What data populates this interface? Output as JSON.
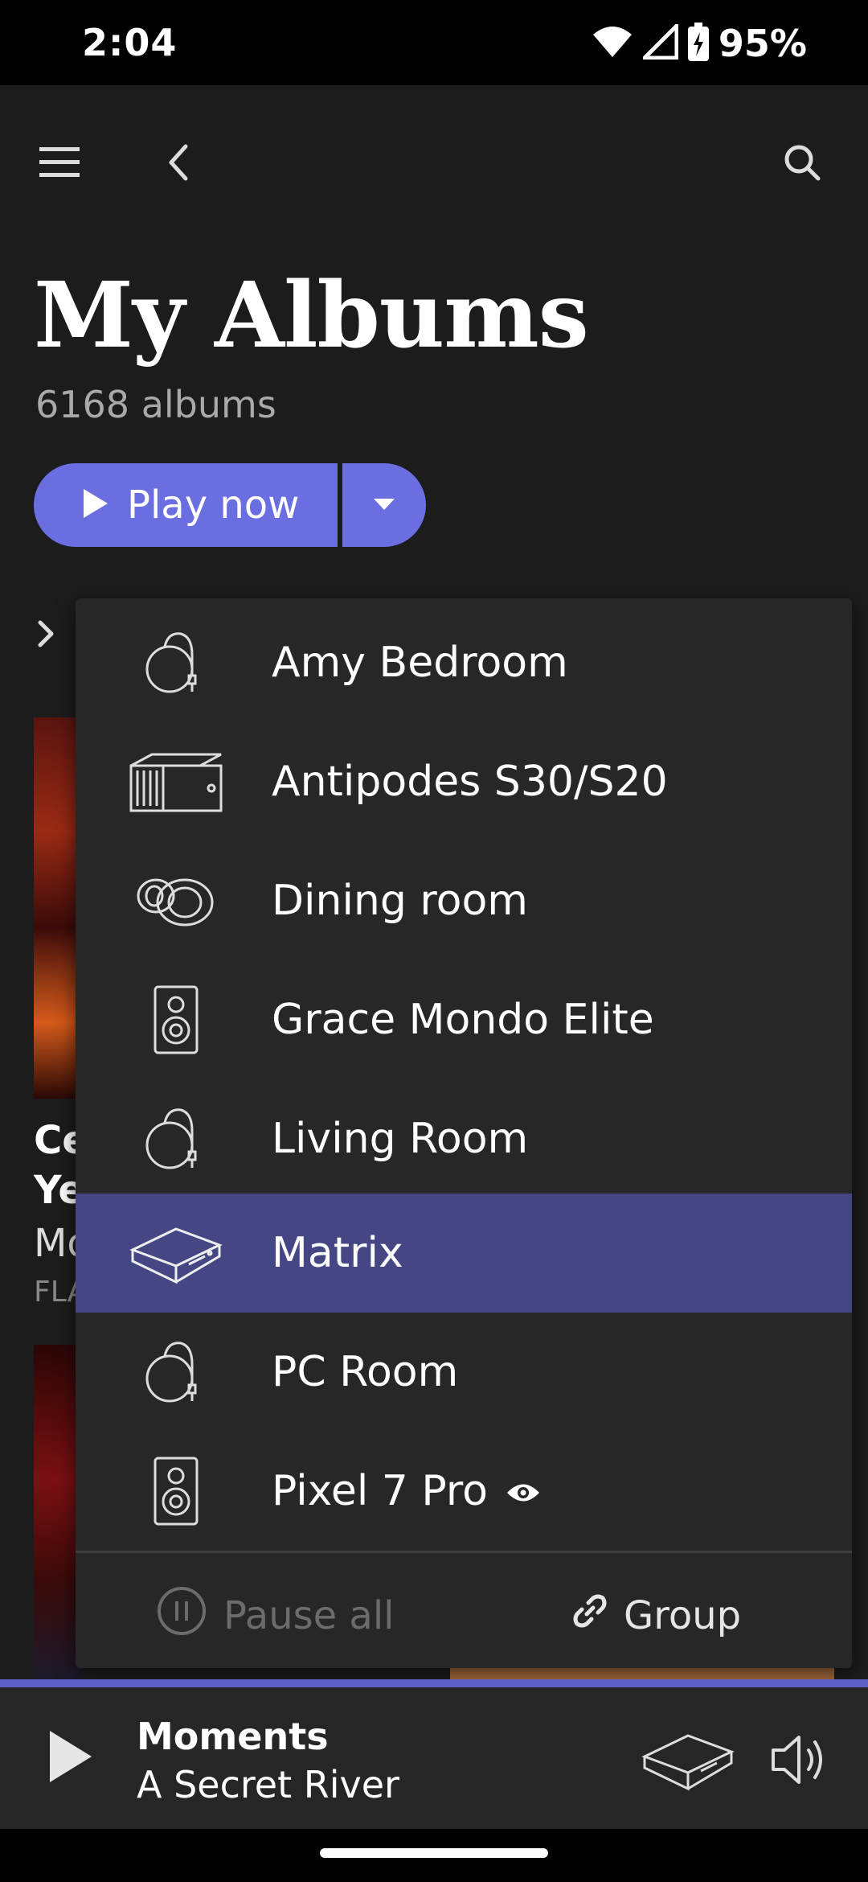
{
  "status_bar": {
    "time": "2:04",
    "battery": "95%",
    "icons": [
      "wifi-icon",
      "signal-icon",
      "battery-charging-icon"
    ]
  },
  "toolbar": {
    "icons": [
      "hamburger-menu-icon",
      "back-arrow-icon",
      "search-icon"
    ]
  },
  "page": {
    "title": "My Albums",
    "subtitle": "6168 albums"
  },
  "actions": {
    "play_now_label": "Play now",
    "dropdown_icon": "caret-down-icon"
  },
  "background_album": {
    "line1": "Ce",
    "line2": "Ye",
    "line3": "Mo",
    "line4": "FLA"
  },
  "zone_menu": {
    "items": [
      {
        "label": "Amy Bedroom",
        "icon": "round-speaker-icon",
        "selected": false
      },
      {
        "label": "Antipodes S30/S20",
        "icon": "server-box-icon",
        "selected": false
      },
      {
        "label": "Dining room",
        "icon": "oval-speaker-icon",
        "selected": false
      },
      {
        "label": "Grace Mondo Elite",
        "icon": "bookshelf-speaker-icon",
        "selected": false
      },
      {
        "label": "Living Room",
        "icon": "round-speaker-icon",
        "selected": false
      },
      {
        "label": "Matrix",
        "icon": "streamer-device-icon",
        "selected": true
      },
      {
        "label": "PC Room",
        "icon": "round-speaker-icon",
        "selected": false
      },
      {
        "label": "Pixel 7 Pro",
        "icon": "bookshelf-speaker-icon",
        "selected": false,
        "badge_icon": "eye-icon"
      }
    ],
    "pause_all_label": "Pause all",
    "group_label": "Group"
  },
  "now_playing": {
    "title": "Moments",
    "artist": "A Secret River",
    "accent_color": "#5e60c8"
  },
  "colors": {
    "accent": "#6b6ee0",
    "selected_row": "#454785",
    "menu_bg": "#272727",
    "page_bg": "#1c1c1c"
  }
}
